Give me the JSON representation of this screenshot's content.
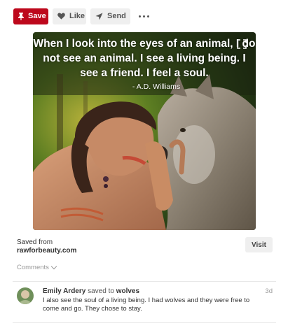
{
  "toolbar": {
    "save_label": "Save",
    "like_label": "Like",
    "send_label": "Send"
  },
  "pin": {
    "quote_text": "When I look into the eyes of an animal, I do not see an animal. I see a living being. I see a friend. I feel a soul.",
    "quote_author": "- A.D. Williams"
  },
  "source": {
    "saved_from_label": "Saved from",
    "domain": "rawforbeauty.com",
    "visit_label": "Visit"
  },
  "comments": {
    "toggle_label": "Comments",
    "items": [
      {
        "user": "Emily Ardery",
        "action": "saved to",
        "board": "wolves",
        "time": "3d",
        "text": "I also see the soul of a living being. I had wolves and they were free to come and go. They chose to stay."
      }
    ]
  },
  "colors": {
    "save_red": "#bd081c",
    "button_grey": "#efefef"
  }
}
